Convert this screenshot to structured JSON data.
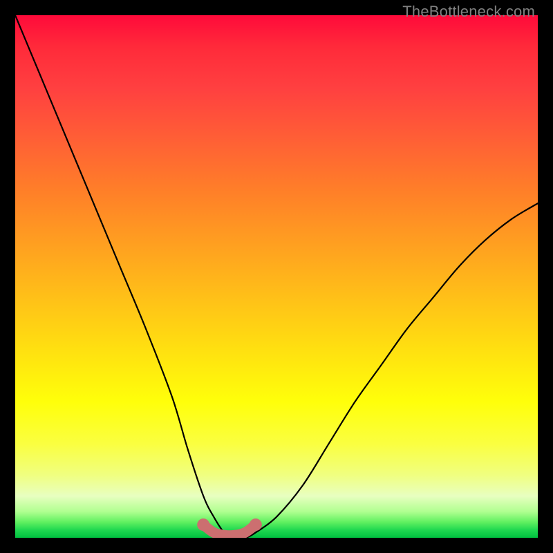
{
  "watermark": "TheBottleneck.com",
  "chart_data": {
    "type": "line",
    "title": "",
    "xlabel": "",
    "ylabel": "",
    "xlim": [
      0,
      1
    ],
    "ylim": [
      0,
      1
    ],
    "series": [
      {
        "name": "bottleneck-curve",
        "x": [
          0.0,
          0.05,
          0.1,
          0.15,
          0.2,
          0.25,
          0.3,
          0.33,
          0.36,
          0.38,
          0.4,
          0.42,
          0.44,
          0.46,
          0.5,
          0.55,
          0.6,
          0.65,
          0.7,
          0.75,
          0.8,
          0.85,
          0.9,
          0.95,
          1.0
        ],
        "y": [
          1.0,
          0.88,
          0.76,
          0.64,
          0.52,
          0.4,
          0.27,
          0.17,
          0.08,
          0.04,
          0.01,
          0.0,
          0.0,
          0.01,
          0.04,
          0.1,
          0.18,
          0.26,
          0.33,
          0.4,
          0.46,
          0.52,
          0.57,
          0.61,
          0.64
        ]
      },
      {
        "name": "flat-region-highlight",
        "x": [
          0.36,
          0.38,
          0.4,
          0.42,
          0.44,
          0.46
        ],
        "y": [
          0.025,
          0.01,
          0.005,
          0.005,
          0.01,
          0.025
        ]
      }
    ],
    "colors": {
      "curve": "#000000",
      "highlight": "#cc6f70",
      "gradient_top": "#ff0a3a",
      "gradient_bottom": "#00c040"
    }
  }
}
